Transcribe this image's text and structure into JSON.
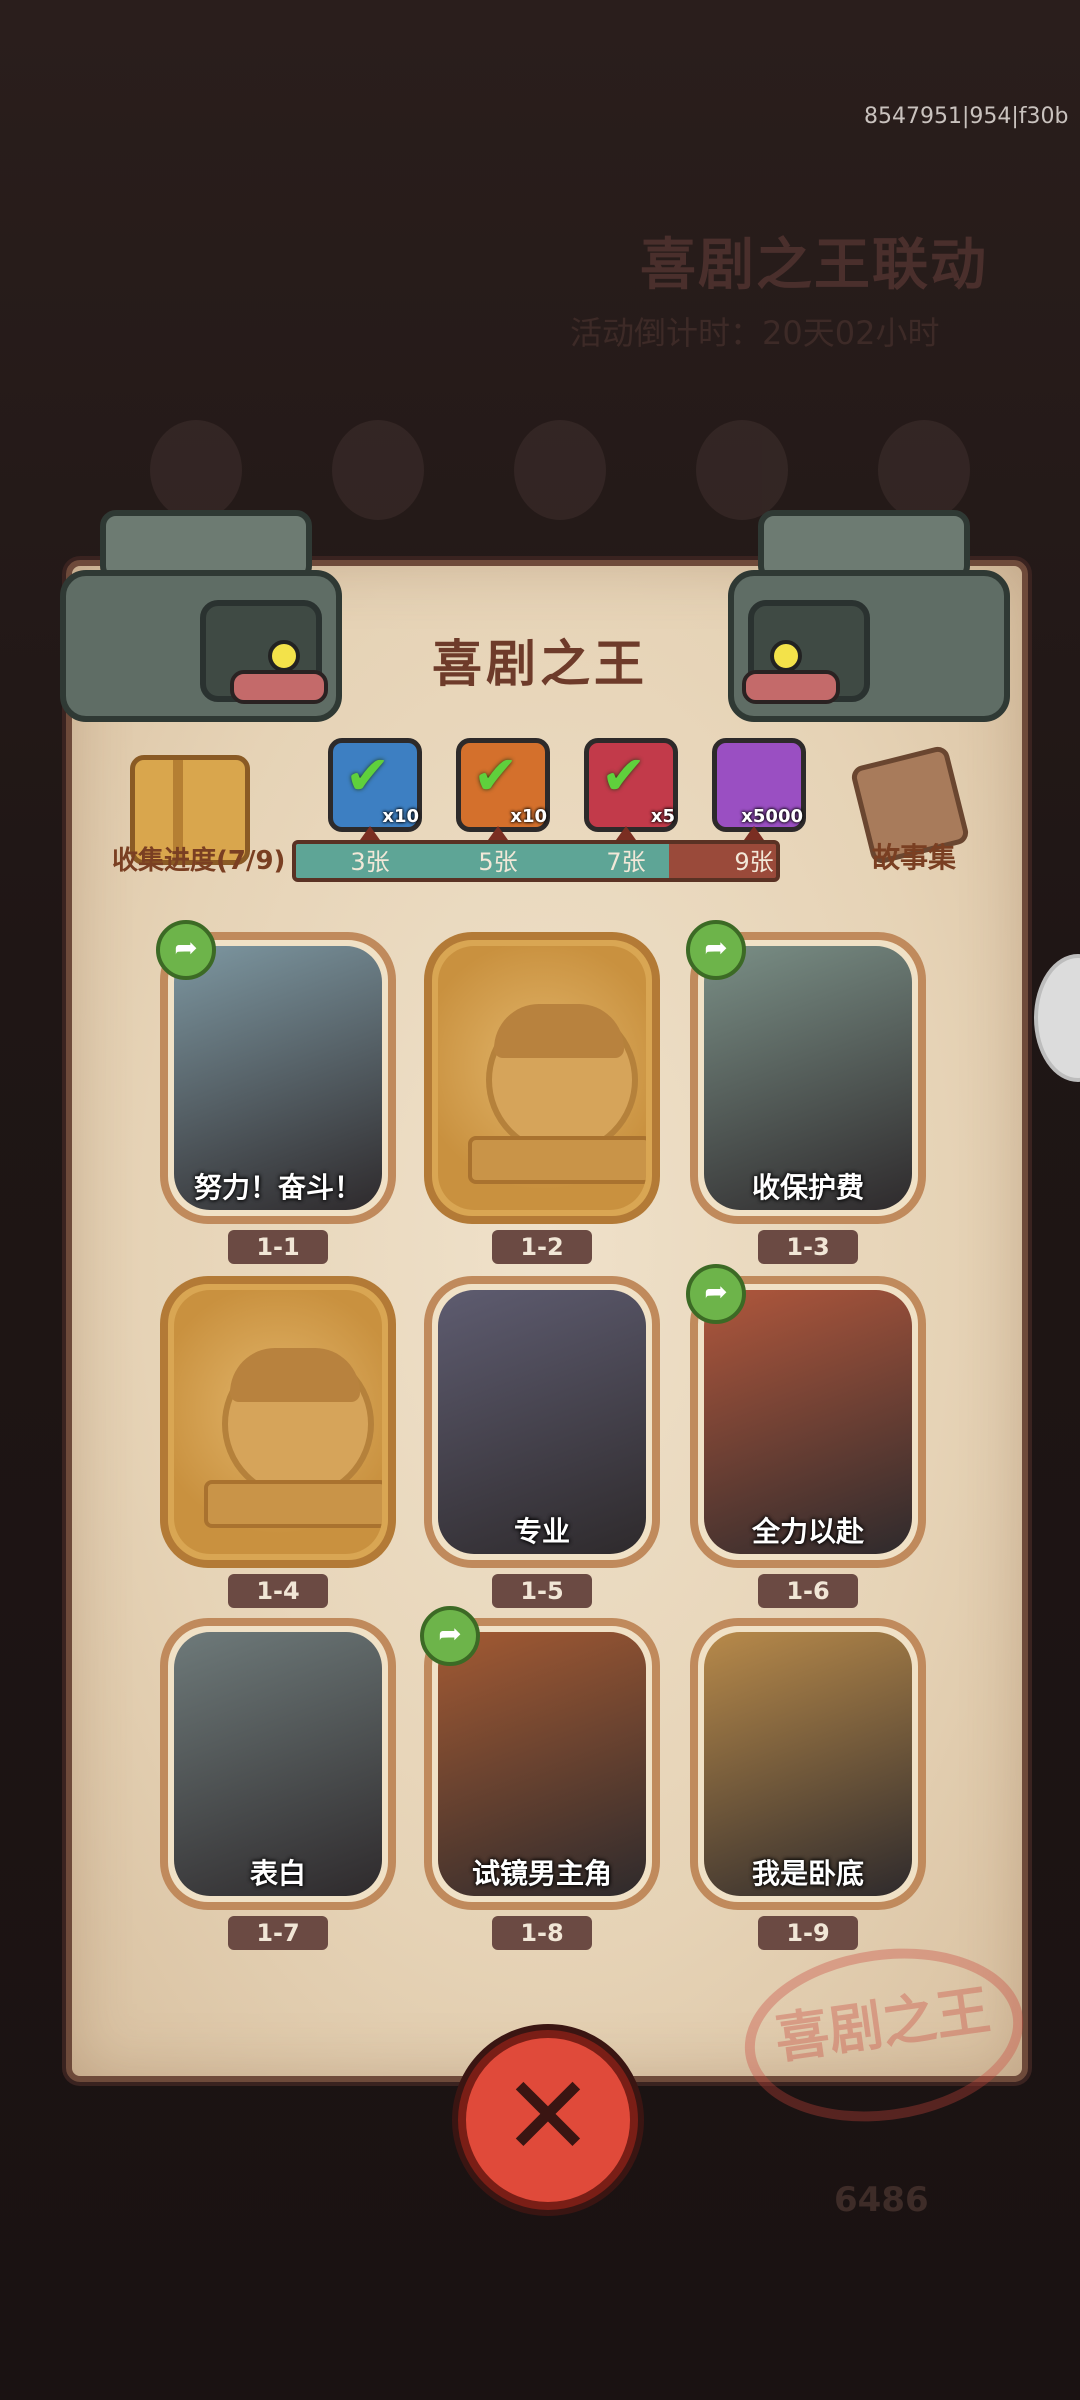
{
  "version_id": "8547951|954|f30b",
  "background": {
    "event_title": "喜剧之王联动",
    "timer_text": "活动倒计时：20天02小时",
    "coin_count": "6486"
  },
  "panel": {
    "title": "喜剧之王",
    "progress_label": "收集进度(7/9)",
    "story_label": "故事集",
    "progress": {
      "collected": 7,
      "total": 9
    },
    "milestones": [
      {
        "label": "3张",
        "reward_qty": "x10",
        "claimed": true,
        "color": "#3d7fc2",
        "icon": "crate-icon"
      },
      {
        "label": "5张",
        "reward_qty": "x10",
        "claimed": true,
        "color": "#d4702c",
        "icon": "crate-icon"
      },
      {
        "label": "7张",
        "reward_qty": "x5",
        "claimed": true,
        "color": "#c23a4a",
        "icon": "orb-icon"
      },
      {
        "label": "9张",
        "reward_qty": "x5000",
        "claimed": false,
        "color": "#9a4fc2",
        "icon": "diamond-icon"
      }
    ],
    "stamp_text": "喜剧之王",
    "cards": [
      {
        "id": "1-1",
        "caption": "努力！奋斗！",
        "unlocked": true,
        "shareable": true,
        "tone": "#7d97a1"
      },
      {
        "id": "1-2",
        "caption": "",
        "unlocked": false,
        "shareable": false,
        "tone": ""
      },
      {
        "id": "1-3",
        "caption": "收保护费",
        "unlocked": true,
        "shareable": true,
        "tone": "#7a8f86"
      },
      {
        "id": "1-4",
        "caption": "",
        "unlocked": false,
        "shareable": false,
        "tone": ""
      },
      {
        "id": "1-5",
        "caption": "专业",
        "unlocked": true,
        "shareable": false,
        "tone": "#5e5c70"
      },
      {
        "id": "1-6",
        "caption": "全力以赴",
        "unlocked": true,
        "shareable": true,
        "tone": "#b0573c"
      },
      {
        "id": "1-7",
        "caption": "表白",
        "unlocked": true,
        "shareable": false,
        "tone": "#6e7a7a"
      },
      {
        "id": "1-8",
        "caption": "试镜男主角",
        "unlocked": true,
        "shareable": true,
        "tone": "#a35a33"
      },
      {
        "id": "1-9",
        "caption": "我是卧底",
        "unlocked": true,
        "shareable": false,
        "tone": "#b88a4a"
      }
    ]
  }
}
